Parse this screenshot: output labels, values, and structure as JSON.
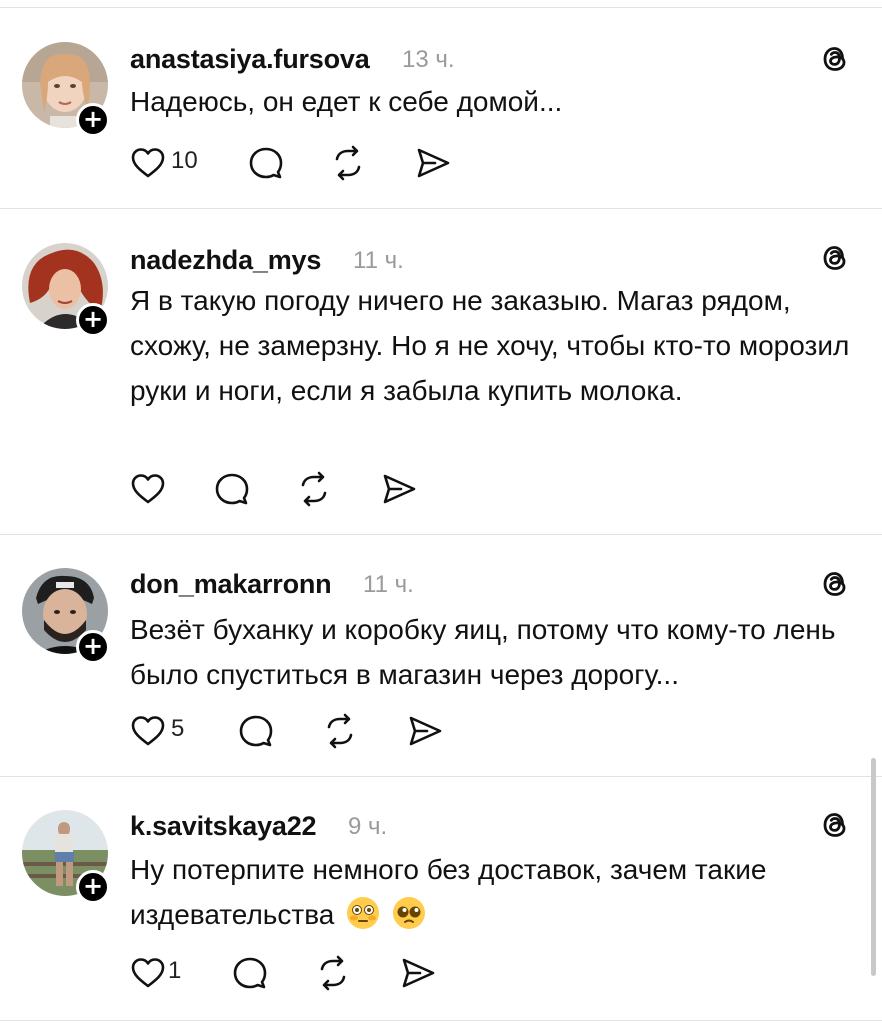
{
  "posts": [
    {
      "username": "anastasiya.fursova",
      "time": "13 ч.",
      "text": "Надеюсь, он едет к себе домой...",
      "likes": "10"
    },
    {
      "username": "nadezhda_mys",
      "time": "11 ч.",
      "text": "Я в такую погоду ничего не заказыю. Магаз рядом, схожу, не замерзну. Но я не хочу, чтобы кто-то морозил руки и ноги, если я забыла купить молока.",
      "likes": ""
    },
    {
      "username": "don_makarronn",
      "time": "11 ч.",
      "text": "Везёт буханку и коробку яиц, потому что кому-то лень было спуститься в магазин через дорогу...",
      "likes": "5"
    },
    {
      "username": "k.savitskaya22",
      "time": "9 ч.",
      "text": "Ну потерпите немного без доставок, зачем такие издевательства",
      "emoji": [
        "flushed-face",
        "pleading-face"
      ],
      "likes": "1"
    }
  ],
  "icons": {
    "like": "heart-icon",
    "comment": "comment-bubble-icon",
    "repost": "repost-icon",
    "share": "send-icon",
    "threads": "threads-logo-icon",
    "follow": "plus-icon"
  }
}
